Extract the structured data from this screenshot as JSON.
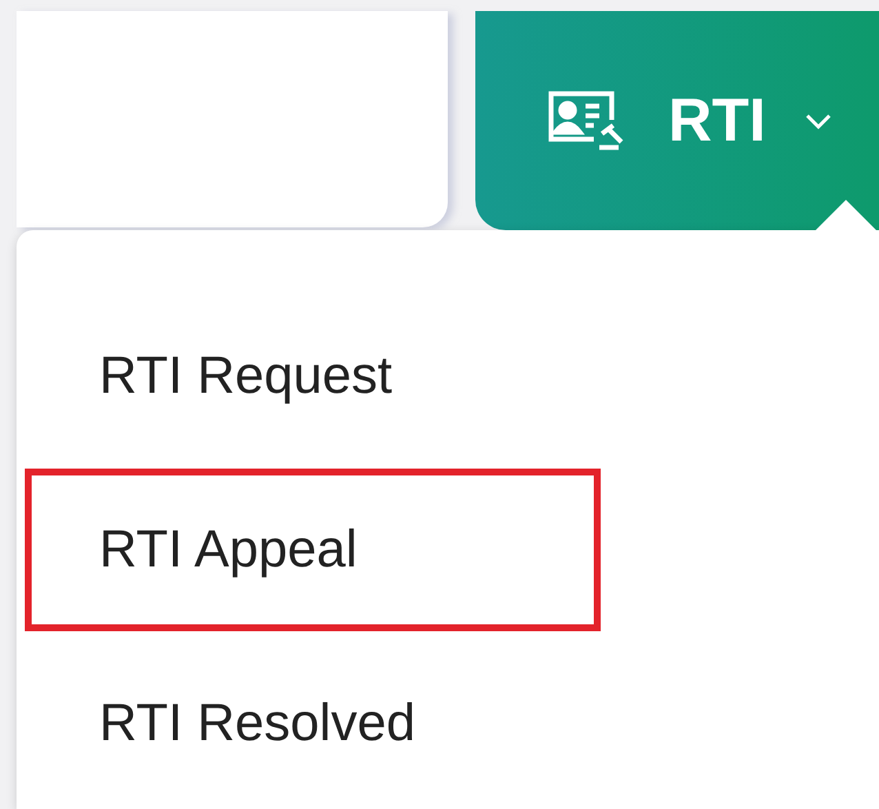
{
  "nav_tab": {
    "label": "RTI",
    "expanded": true
  },
  "menu": {
    "items": [
      {
        "label": "RTI Request",
        "highlighted": false
      },
      {
        "label": "RTI Appeal",
        "highlighted": true
      },
      {
        "label": "RTI Resolved",
        "highlighted": false
      }
    ]
  }
}
